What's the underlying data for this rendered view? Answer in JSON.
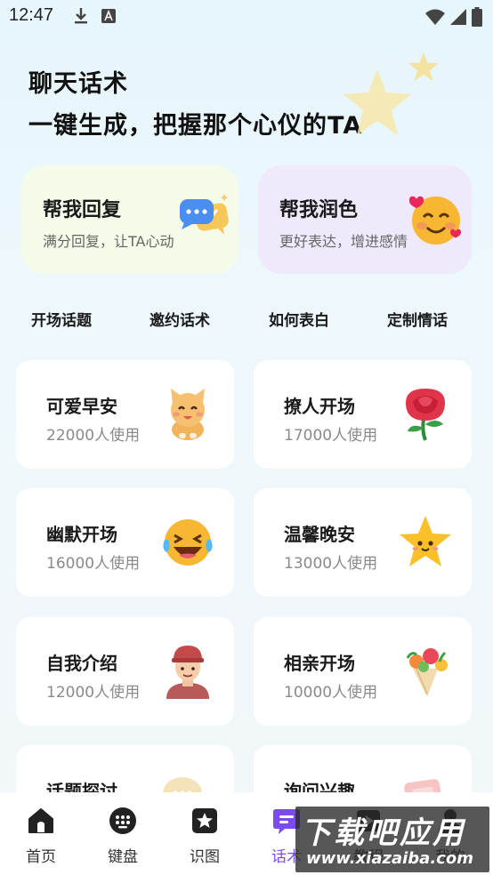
{
  "status_bar": {
    "time": "12:47"
  },
  "header": {
    "title": "聊天话术",
    "subtitle": "一键生成，把握那个心仪的TA"
  },
  "features": [
    {
      "title": "帮我回复",
      "desc": "满分回复，让TA心动"
    },
    {
      "title": "帮我润色",
      "desc": "更好表达，增进感情"
    }
  ],
  "categories": [
    "开场话题",
    "邀约话术",
    "如何表白",
    "定制情话"
  ],
  "templates": [
    {
      "name": "可爱早安",
      "usage": "22000人使用",
      "icon": "cat-icon"
    },
    {
      "name": "撩人开场",
      "usage": "17000人使用",
      "icon": "rose-icon"
    },
    {
      "name": "幽默开场",
      "usage": "16000人使用",
      "icon": "laughing-emoji-icon"
    },
    {
      "name": "温馨晚安",
      "usage": "13000人使用",
      "icon": "star-icon"
    },
    {
      "name": "自我介绍",
      "usage": "12000人使用",
      "icon": "person-icon"
    },
    {
      "name": "相亲开场",
      "usage": "10000人使用",
      "icon": "bouquet-icon"
    },
    {
      "name": "话题探讨",
      "usage": "",
      "icon": "chat-bubble-icon"
    },
    {
      "name": "询问兴趣",
      "usage": "",
      "icon": "card-icon"
    }
  ],
  "nav": [
    {
      "label": "首页",
      "icon": "home-icon"
    },
    {
      "label": "键盘",
      "icon": "keyboard-icon"
    },
    {
      "label": "识图",
      "icon": "image-recognize-icon"
    },
    {
      "label": "话术",
      "icon": "chat-script-icon",
      "active": true
    },
    {
      "label": "教程",
      "icon": "tutorial-icon"
    },
    {
      "label": "我的",
      "icon": "profile-icon"
    }
  ],
  "watermark": {
    "big": "下载吧应用",
    "small": "www.xiazaiba.com"
  },
  "colors": {
    "accent": "#7b4bf0",
    "reply_bg": "#f4fbe8",
    "polish_bg": "#f0e8fb"
  }
}
